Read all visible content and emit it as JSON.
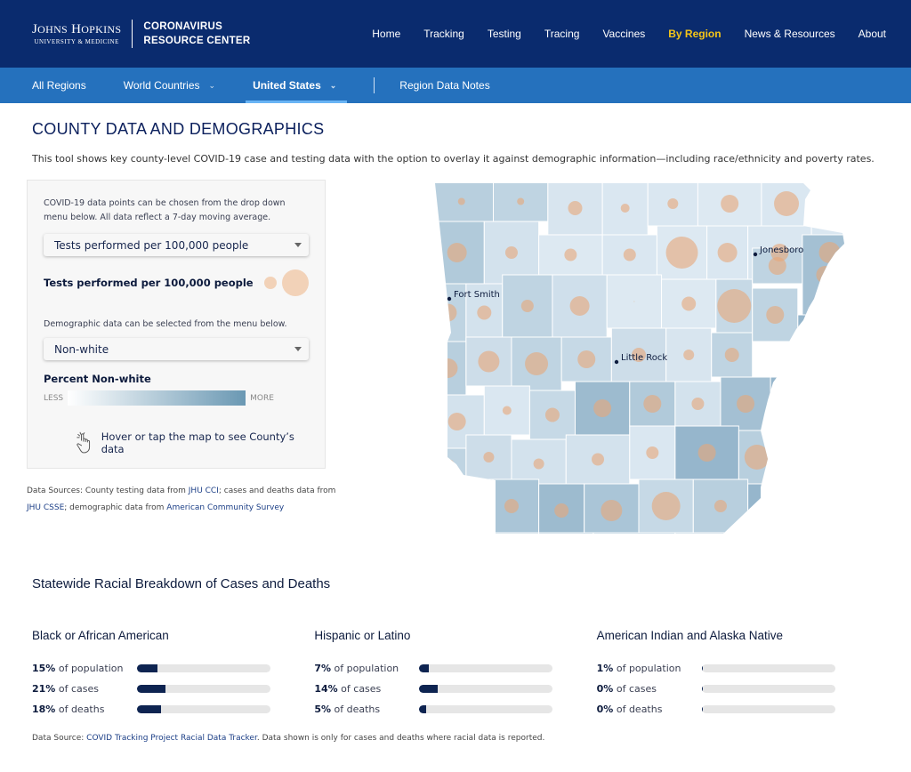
{
  "header": {
    "logo_main": "Johns Hopkins",
    "logo_sub": "UNIVERSITY & MEDICINE",
    "site_title_line1": "CORONAVIRUS",
    "site_title_line2": "RESOURCE CENTER",
    "nav": [
      {
        "label": "Home",
        "active": false
      },
      {
        "label": "Tracking",
        "active": false
      },
      {
        "label": "Testing",
        "active": false
      },
      {
        "label": "Tracing",
        "active": false
      },
      {
        "label": "Vaccines",
        "active": false
      },
      {
        "label": "By Region",
        "active": true
      },
      {
        "label": "News & Resources",
        "active": false
      },
      {
        "label": "About",
        "active": false
      }
    ]
  },
  "subnav": {
    "all_regions": "All Regions",
    "world_countries": "World Countries",
    "united_states": "United States",
    "region_notes": "Region Data Notes"
  },
  "page": {
    "title": "COUNTY DATA AND DEMOGRAPHICS",
    "intro": "This tool shows key county-level COVID-19 case and testing data with the option to overlay it against demographic information—including race/ethnicity and poverty rates."
  },
  "panel": {
    "note1": "COVID-19 data points can be chosen from the drop down menu below. All data reflect a 7-day moving average.",
    "covid_select": "Tests performed per 100,000 people",
    "size_legend_label": "Tests performed per 100,000 people",
    "note2": "Demographic data can be selected from the menu below.",
    "demo_select": "Non-white",
    "pct_label": "Percent Non-white",
    "less": "LESS",
    "more": "MORE",
    "hover_hint": "Hover or tap the map to see County’s data"
  },
  "sources": {
    "p1": "Data Sources: County testing data from ",
    "l1": "JHU CCI",
    "p2": "; cases and deaths data from ",
    "l2": "JHU CSSE",
    "p3": "; demographic data from ",
    "l3": "American Community Survey"
  },
  "map": {
    "state": "Arkansas",
    "colors": {
      "bubble": "#e8a678",
      "low": "#e8f1f8",
      "high": "#5f8fae"
    },
    "cities": [
      {
        "name": "Fort Smith"
      },
      {
        "name": "Jonesboro"
      },
      {
        "name": "Little Rock"
      }
    ]
  },
  "breakdown": {
    "title": "Statewide Racial Breakdown of Cases and Deaths",
    "groups": [
      {
        "name": "Black or African American",
        "stats": [
          {
            "pct": "15%",
            "label": " of population",
            "value": 15
          },
          {
            "pct": "21%",
            "label": " of cases",
            "value": 21
          },
          {
            "pct": "18%",
            "label": " of deaths",
            "value": 18
          }
        ]
      },
      {
        "name": "Hispanic or Latino",
        "stats": [
          {
            "pct": "7%",
            "label": " of population",
            "value": 7
          },
          {
            "pct": "14%",
            "label": " of cases",
            "value": 14
          },
          {
            "pct": "5%",
            "label": " of deaths",
            "value": 5
          }
        ]
      },
      {
        "name": "American Indian and Alaska Native",
        "stats": [
          {
            "pct": "1%",
            "label": " of population",
            "value": 1
          },
          {
            "pct": "0%",
            "label": " of cases",
            "value": 0
          },
          {
            "pct": "0%",
            "label": " of deaths",
            "value": 0
          }
        ]
      }
    ],
    "footer_p1": "Data Source: ",
    "footer_link": "COVID Tracking Project Racial Data Tracker",
    "footer_p2": ". Data shown is only for cases and deaths where racial data is reported."
  }
}
